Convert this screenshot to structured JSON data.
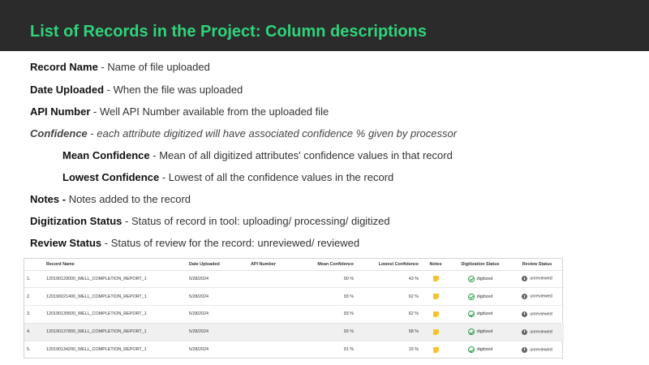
{
  "slide": {
    "title": "List of Records in the Project: Column descriptions",
    "header_color": "#2b2b2b",
    "title_color": "#2ed47a"
  },
  "descriptions": [
    {
      "term": "Record Name",
      "sep": " - ",
      "text": "Name of file uploaded"
    },
    {
      "term": "Date Uploaded",
      "sep": " - ",
      "text": "When the file was uploaded"
    },
    {
      "term": "API Number",
      "sep": " - ",
      "text": "Well API Number available from the uploaded file"
    },
    {
      "term": "Confidence",
      "sep": " - ",
      "text": "each attribute digitized will have associated confidence % given by processor"
    },
    {
      "term": "Mean Confidence",
      "sep": " - ",
      "text": "Mean of all digitized attributes' confidence values in that record"
    },
    {
      "term": "Lowest Confidence",
      "sep": " - ",
      "text": "Lowest of all the confidence values in the record"
    },
    {
      "term": "Notes -",
      "sep": " ",
      "text": "Notes added to the record"
    },
    {
      "term": "Digitization Status",
      "sep": " - ",
      "text": "Status of record in tool: uploading/ processing/ digitized"
    },
    {
      "term": "Review Status",
      "sep": " - ",
      "text": "Status of review for the record: unreviewed/ reviewed"
    }
  ],
  "table": {
    "headers": {
      "record_name": "Record Name",
      "date_uploaded": "Date Uploaded",
      "api_number": "API Number",
      "mean_confidence": "Mean Confidence",
      "lowest_confidence": "Lowest Confidence",
      "notes": "Notes",
      "digitization_status": "Digitization Status",
      "review_status": "Review Status"
    },
    "rows": [
      {
        "index": "1.",
        "record_name": "120190129000_WELL_COMPLETION_REPORT_1",
        "date_uploaded": "5/28/2024",
        "api_number": "",
        "mean_confidence": "90 %",
        "lowest_confidence": "43 %",
        "digitization_status": "digitized",
        "review_status": "unreviewed"
      },
      {
        "index": "2.",
        "record_name": "120190021400_WELL_COMPLETION_REPORT_1",
        "date_uploaded": "5/28/2024",
        "api_number": "",
        "mean_confidence": "93 %",
        "lowest_confidence": "62 %",
        "digitization_status": "digitized",
        "review_status": "unreviewed"
      },
      {
        "index": "3.",
        "record_name": "120190139500_WELL_COMPLETION_REPORT_1",
        "date_uploaded": "5/28/2024",
        "api_number": "",
        "mean_confidence": "93 %",
        "lowest_confidence": "62 %",
        "digitization_status": "digitized",
        "review_status": "unreviewed"
      },
      {
        "index": "4.",
        "record_name": "120190137800_WELL_COMPLETION_REPORT_1",
        "date_uploaded": "5/28/2024",
        "api_number": "",
        "mean_confidence": "93 %",
        "lowest_confidence": "58 %",
        "digitization_status": "digitized",
        "review_status": "unreviewed"
      },
      {
        "index": "5.",
        "record_name": "120190134200_WELL_COMPLETION_REPORT_1",
        "date_uploaded": "5/28/2024",
        "api_number": "",
        "mean_confidence": "91 %",
        "lowest_confidence": "15 %",
        "digitization_status": "digitized",
        "review_status": "unreviewed"
      }
    ],
    "icons": {
      "notes": "sticky-note-icon",
      "digitized": "check-circle-icon",
      "unreviewed": "info-circle-icon"
    }
  }
}
